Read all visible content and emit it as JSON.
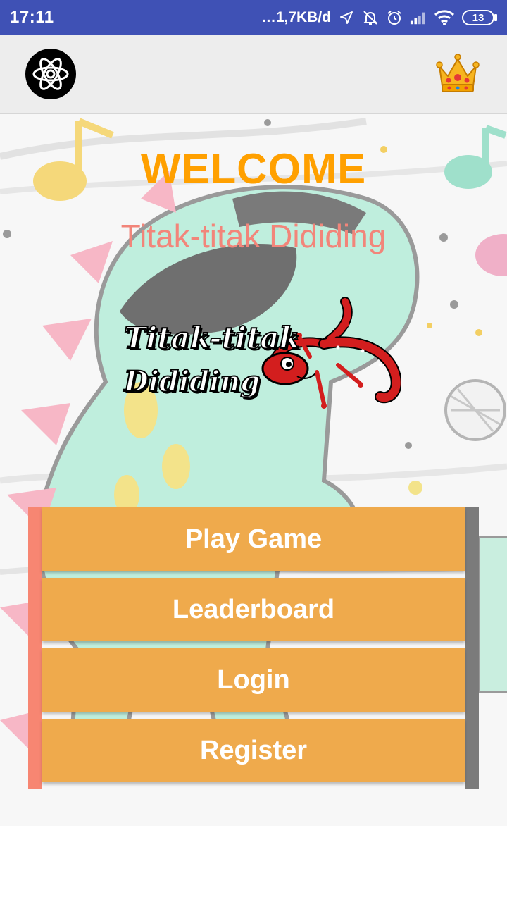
{
  "status_bar": {
    "time": "17:11",
    "net_speed": "…1,7KB/d",
    "battery_level": "13",
    "icons": [
      "location-arrow-icon",
      "alarm-muted-icon",
      "alarm-clock-icon",
      "signal-icon",
      "wifi-icon",
      "battery-icon"
    ]
  },
  "app_bar": {
    "logo_icon": "atom-icon",
    "leaderboard_icon": "crown-icon"
  },
  "welcome": {
    "title": "WELCOME",
    "subtitle": "Titak-titak Dididing"
  },
  "game_logo": {
    "line1": "Titak-titak",
    "line2": "Dididing",
    "mascot": "red-gecko"
  },
  "menu": {
    "play_label": "Play Game",
    "leaderboard_label": "Leaderboard",
    "login_label": "Login",
    "register_label": "Register"
  },
  "colors": {
    "status_bar": "#3f51b5",
    "app_bar": "#ededed",
    "welcome_title": "#ffa000",
    "subtitle": "#f2857a",
    "button": "#efaa4c",
    "accent_left": "#f78672",
    "accent_right": "#7b7b7b"
  }
}
